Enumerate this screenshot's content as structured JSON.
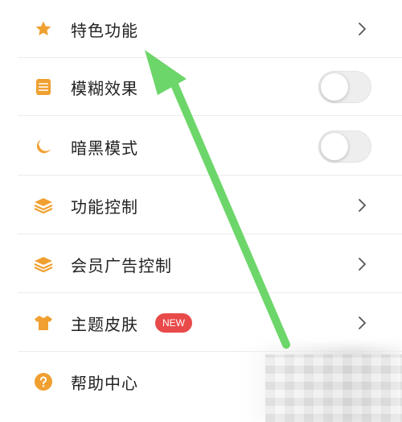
{
  "settings": {
    "items": [
      {
        "label": "特色功能",
        "icon": "star-icon",
        "control": "chevron"
      },
      {
        "label": "模糊效果",
        "icon": "layers-stack-icon",
        "control": "toggle",
        "toggle_on": false
      },
      {
        "label": "暗黑模式",
        "icon": "moon-icon",
        "control": "toggle",
        "toggle_on": false
      },
      {
        "label": "功能控制",
        "icon": "stacked-layers-icon",
        "control": "chevron"
      },
      {
        "label": "会员广告控制",
        "icon": "stacked-layers-icon",
        "control": "chevron"
      },
      {
        "label": "主题皮肤",
        "icon": "tshirt-icon",
        "control": "chevron",
        "badge": "NEW"
      },
      {
        "label": "帮助中心",
        "icon": "question-icon",
        "control": "none"
      }
    ]
  },
  "colors": {
    "icon_accent": "#f0a030",
    "badge_red": "#e84a4a",
    "annotation_arrow": "#6dd66a",
    "toggle_off_track": "#eeeeee"
  }
}
